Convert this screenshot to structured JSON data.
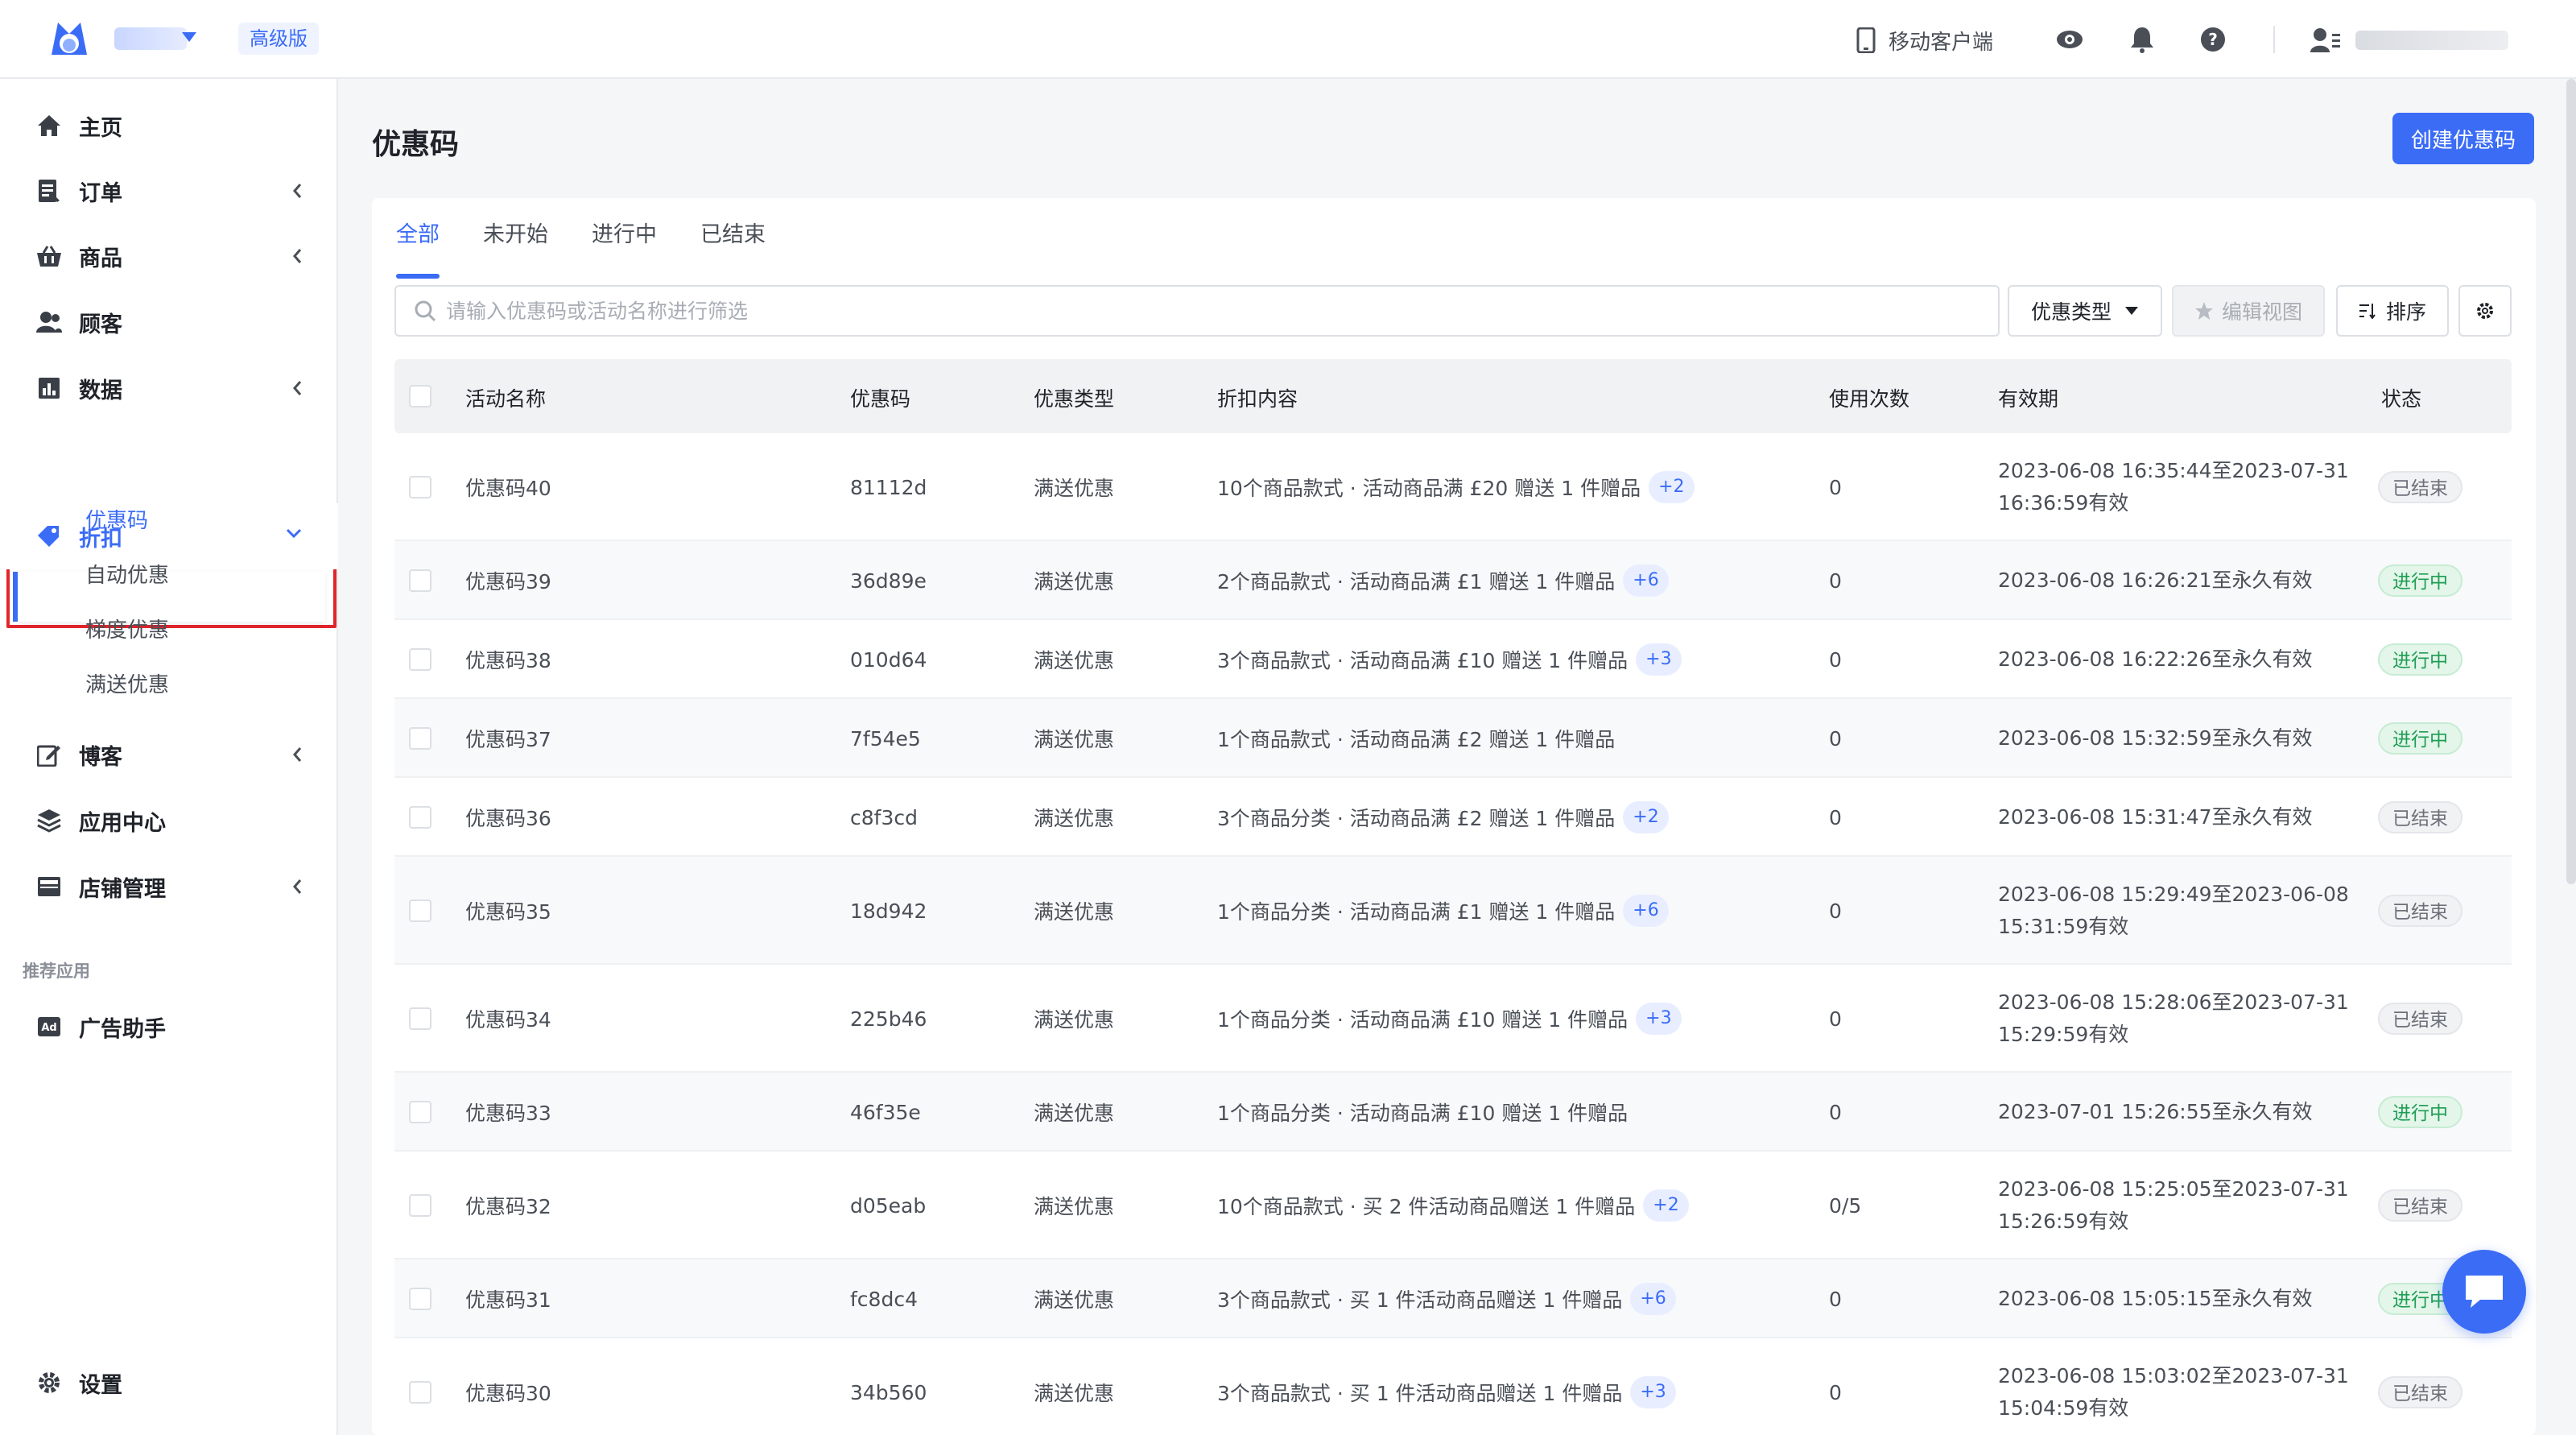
{
  "header": {
    "plan_label": "高级版",
    "mobile_label": "移动客户端",
    "icons": [
      "eye-icon",
      "bell-icon",
      "help-icon",
      "user-icon"
    ]
  },
  "sidebar": {
    "items": [
      {
        "label": "主页",
        "icon": "home-icon",
        "has_chevron": false
      },
      {
        "label": "订单",
        "icon": "orders-icon",
        "has_chevron": true
      },
      {
        "label": "商品",
        "icon": "basket-icon",
        "has_chevron": true
      },
      {
        "label": "顾客",
        "icon": "customers-icon",
        "has_chevron": false
      },
      {
        "label": "数据",
        "icon": "chart-icon",
        "has_chevron": true
      },
      {
        "label": "折扣",
        "icon": "tag-icon",
        "has_chevron": true,
        "expanded": true
      },
      {
        "label": "博客",
        "icon": "edit-icon",
        "has_chevron": true
      },
      {
        "label": "应用中心",
        "icon": "layers-icon",
        "has_chevron": false
      },
      {
        "label": "店铺管理",
        "icon": "store-icon",
        "has_chevron": true
      }
    ],
    "sub_items": [
      "优惠码",
      "自动优惠",
      "梯度优惠",
      "满送优惠"
    ],
    "section_label": "推荐应用",
    "ad_label": "广告助手",
    "settings_label": "设置"
  },
  "main": {
    "title": "优惠码",
    "create_button": "创建优惠码",
    "tabs": [
      "全部",
      "未开始",
      "进行中",
      "已结束"
    ],
    "search_placeholder": "请输入优惠码或活动名称进行筛选",
    "type_filter": "优惠类型",
    "edit_view": "编辑视图",
    "sort": "排序",
    "columns": [
      "活动名称",
      "优惠码",
      "优惠类型",
      "折扣内容",
      "使用次数",
      "有效期",
      "状态"
    ],
    "rows": [
      {
        "name": "优惠码40",
        "code": "81112d",
        "type": "满送优惠",
        "content": "10个商品款式 · 活动商品满 £20 赠送 1 件赠品",
        "more": "+2",
        "uses": "0",
        "validity": [
          "2023-06-08 16:35:44至2023-07-31",
          "16:36:59有效"
        ],
        "status": "已结束",
        "status_kind": "ended"
      },
      {
        "name": "优惠码39",
        "code": "36d89e",
        "type": "满送优惠",
        "content": "2个商品款式 · 活动商品满 £1 赠送 1 件赠品",
        "more": "+6",
        "uses": "0",
        "validity": [
          "2023-06-08 16:26:21至永久有效"
        ],
        "status": "进行中",
        "status_kind": "active"
      },
      {
        "name": "优惠码38",
        "code": "010d64",
        "type": "满送优惠",
        "content": "3个商品款式 · 活动商品满 £10 赠送 1 件赠品",
        "more": "+3",
        "uses": "0",
        "validity": [
          "2023-06-08 16:22:26至永久有效"
        ],
        "status": "进行中",
        "status_kind": "active"
      },
      {
        "name": "优惠码37",
        "code": "7f54e5",
        "type": "满送优惠",
        "content": "1个商品款式 · 活动商品满 £2 赠送 1 件赠品",
        "more": "",
        "uses": "0",
        "validity": [
          "2023-06-08 15:32:59至永久有效"
        ],
        "status": "进行中",
        "status_kind": "active"
      },
      {
        "name": "优惠码36",
        "code": "c8f3cd",
        "type": "满送优惠",
        "content": "3个商品分类 · 活动商品满 £2 赠送 1 件赠品",
        "more": "+2",
        "uses": "0",
        "validity": [
          "2023-06-08 15:31:47至永久有效"
        ],
        "status": "已结束",
        "status_kind": "ended"
      },
      {
        "name": "优惠码35",
        "code": "18d942",
        "type": "满送优惠",
        "content": "1个商品分类 · 活动商品满 £1 赠送 1 件赠品",
        "more": "+6",
        "uses": "0",
        "validity": [
          "2023-06-08 15:29:49至2023-06-08",
          "15:31:59有效"
        ],
        "status": "已结束",
        "status_kind": "ended"
      },
      {
        "name": "优惠码34",
        "code": "225b46",
        "type": "满送优惠",
        "content": "1个商品分类 · 活动商品满 £10 赠送 1 件赠品",
        "more": "+3",
        "uses": "0",
        "validity": [
          "2023-06-08 15:28:06至2023-07-31",
          "15:29:59有效"
        ],
        "status": "已结束",
        "status_kind": "ended"
      },
      {
        "name": "优惠码33",
        "code": "46f35e",
        "type": "满送优惠",
        "content": "1个商品分类 · 活动商品满 £10 赠送 1 件赠品",
        "more": "",
        "uses": "0",
        "validity": [
          "2023-07-01 15:26:55至永久有效"
        ],
        "status": "进行中",
        "status_kind": "active"
      },
      {
        "name": "优惠码32",
        "code": "d05eab",
        "type": "满送优惠",
        "content": "10个商品款式 · 买 2 件活动商品赠送 1 件赠品",
        "more": "+2",
        "uses": "0/5",
        "validity": [
          "2023-06-08 15:25:05至2023-07-31",
          "15:26:59有效"
        ],
        "status": "已结束",
        "status_kind": "ended"
      },
      {
        "name": "优惠码31",
        "code": "fc8dc4",
        "type": "满送优惠",
        "content": "3个商品款式 · 买 1 件活动商品赠送 1 件赠品",
        "more": "+6",
        "uses": "0",
        "validity": [
          "2023-06-08 15:05:15至永久有效"
        ],
        "status": "进行中",
        "status_kind": "active"
      },
      {
        "name": "优惠码30",
        "code": "34b560",
        "type": "满送优惠",
        "content": "3个商品款式 · 买 1 件活动商品赠送 1 件赠品",
        "more": "+3",
        "uses": "0",
        "validity": [
          "2023-06-08 15:03:02至2023-07-31",
          "15:04:59有效"
        ],
        "status": "已结束",
        "status_kind": "ended"
      }
    ]
  },
  "colors": {
    "accent": "#3b6cf6",
    "highlight": "#e0252c",
    "active_status": "#1f9d55"
  }
}
